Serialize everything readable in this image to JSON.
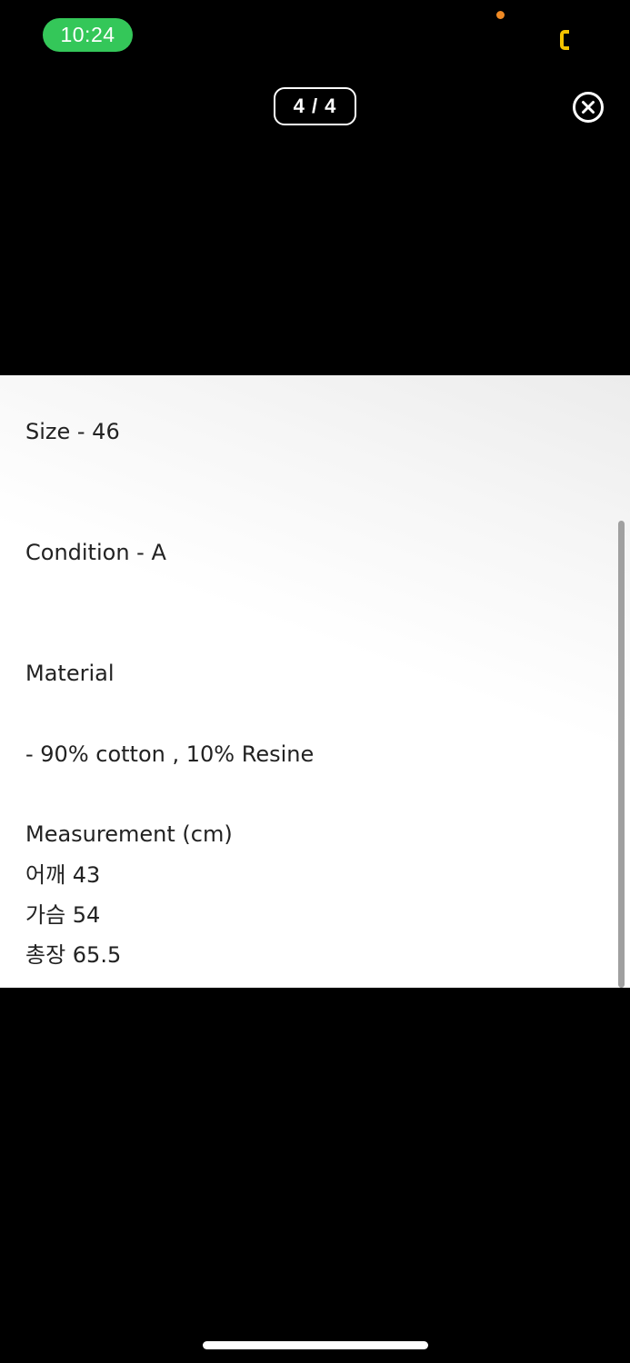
{
  "status_bar": {
    "time": "10:24",
    "icons": [
      "privacy-indicator-dot",
      "battery-icon"
    ],
    "colors": {
      "time_pill": "#34c759",
      "privacy_dot": "#f08a24",
      "battery": "#f5c400"
    }
  },
  "viewer": {
    "page_counter": "4 / 4",
    "close_icon": "close-circle-icon"
  },
  "image": {
    "lines": [
      "Size - 46",
      "Condition - A",
      "Material",
      "- 90% cotton , 10% Resine",
      "Measurement (cm)",
      "어깨 43",
      "가슴 54",
      "총장 65.5"
    ]
  }
}
